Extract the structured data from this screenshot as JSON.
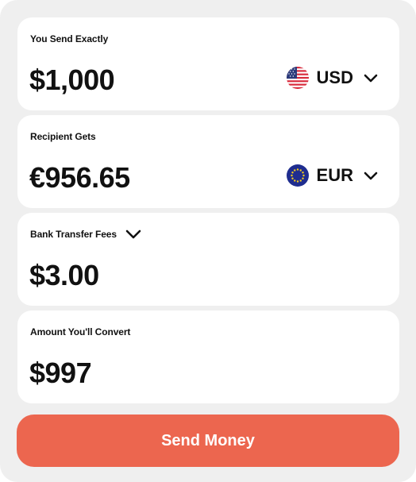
{
  "send_card": {
    "label": "You Send Exactly",
    "amount": "$1,000",
    "currency_code": "USD",
    "flag_icon": "us-flag-icon"
  },
  "receive_card": {
    "label": "Recipient Gets",
    "amount": "€956.65",
    "currency_code": "EUR",
    "flag_icon": "eu-flag-icon"
  },
  "fees_card": {
    "label": "Bank Transfer Fees",
    "amount": "$3.00"
  },
  "convert_card": {
    "label": "Amount You'll Convert",
    "amount": "$997"
  },
  "actions": {
    "send_label": "Send Money"
  },
  "colors": {
    "accent": "#ec664f",
    "panel_bg": "#efefef",
    "card_bg": "#ffffff",
    "text": "#111111"
  }
}
